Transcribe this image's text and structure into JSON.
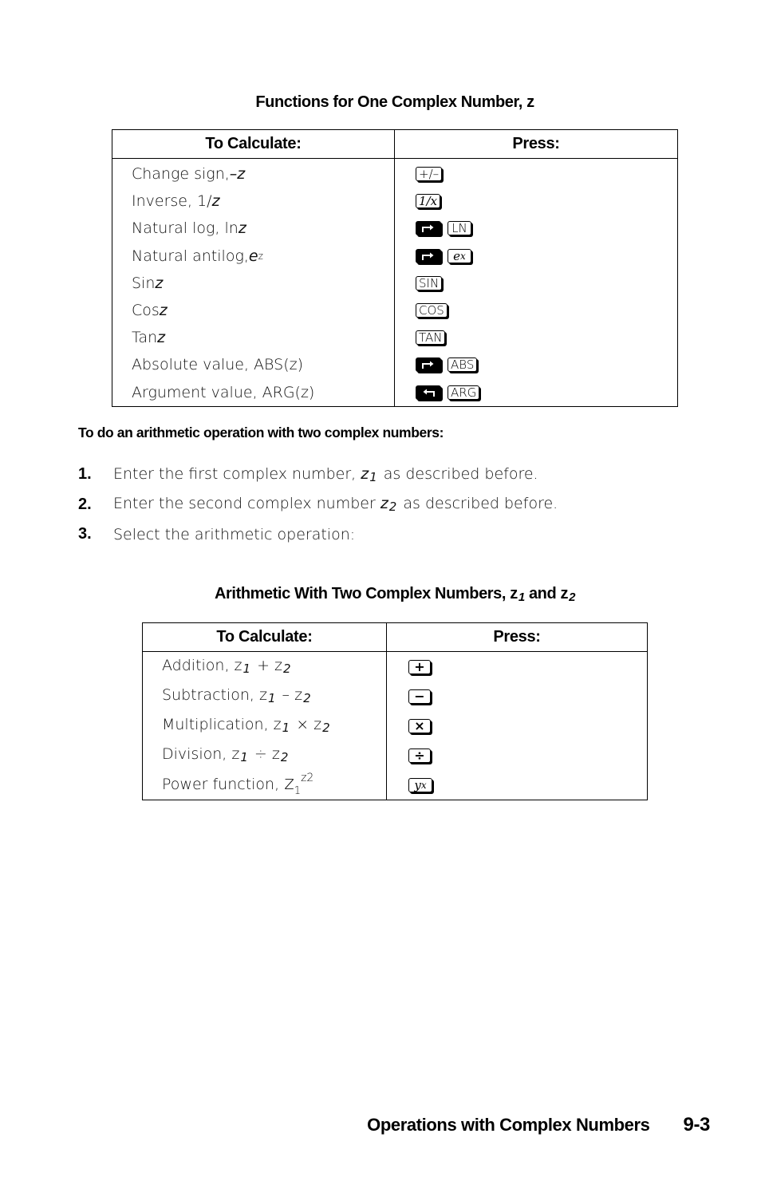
{
  "table1": {
    "title": "Functions for One Complex Number, z",
    "headers": {
      "calc": "To Calculate:",
      "press": "Press:"
    },
    "rows": [
      {
        "label": "Change sign, ",
        "var": "–z",
        "keys": [
          {
            "icon": "plus-minus-key",
            "text": "+/–",
            "style": "normal"
          }
        ]
      },
      {
        "label": "Inverse, 1/",
        "var": "z",
        "keys": [
          {
            "icon": "inverse-key",
            "text": "1/x",
            "style": "serif"
          }
        ]
      },
      {
        "label": "Natural log, ln ",
        "var": "z",
        "keys": [
          {
            "icon": "right-shift-key",
            "text": "",
            "style": "dark-right"
          },
          {
            "icon": "ln-key",
            "text": "LN",
            "style": "normal"
          }
        ]
      },
      {
        "label": "Natural antilog, ",
        "var": "e",
        "sup": "z",
        "keys": [
          {
            "icon": "right-shift-key",
            "text": "",
            "style": "dark-right"
          },
          {
            "icon": "exp-key",
            "text": "e",
            "sup": "x",
            "style": "serif"
          }
        ]
      },
      {
        "label": "Sin ",
        "var": "z",
        "keys": [
          {
            "icon": "sin-key",
            "text": "SIN",
            "style": "normal"
          }
        ]
      },
      {
        "label": "Cos ",
        "var": "z",
        "keys": [
          {
            "icon": "cos-key",
            "text": "COS",
            "style": "normal"
          }
        ]
      },
      {
        "label": "Tan ",
        "var": "z",
        "keys": [
          {
            "icon": "tan-key",
            "text": "TAN",
            "style": "normal"
          }
        ]
      },
      {
        "label": "Absolute value, ABS(z)",
        "var": "",
        "keys": [
          {
            "icon": "right-shift-key",
            "text": "",
            "style": "dark-right"
          },
          {
            "icon": "abs-key",
            "text": "ABS",
            "style": "normal"
          }
        ]
      },
      {
        "label": "Argument value, ARG(z)",
        "var": "",
        "keys": [
          {
            "icon": "left-shift-key",
            "text": "",
            "style": "dark-left"
          },
          {
            "icon": "arg-key",
            "text": "ARG",
            "style": "normal"
          }
        ]
      }
    ]
  },
  "procedure": {
    "heading": "To do an arithmetic operation with two complex numbers:",
    "steps": [
      {
        "num": "1.",
        "before": "Enter the first complex number, ",
        "var": "z",
        "sub": "1",
        "after": " as described before."
      },
      {
        "num": "2.",
        "before": "Enter the second complex number ",
        "var": "z",
        "sub": "2",
        "after": " as described before."
      },
      {
        "num": "3.",
        "before": "Select the arithmetic operation:",
        "var": "",
        "sub": "",
        "after": ""
      }
    ]
  },
  "table2": {
    "title_main": "Arithmetic With Two Complex Numbers, z",
    "title_sub1": "1",
    "title_and": " and z",
    "title_sub2": "2",
    "headers": {
      "calc": "To Calculate:",
      "press": "Press:"
    },
    "rows": [
      {
        "label": "Addition, z",
        "op": " + z",
        "key": {
          "icon": "plus-key",
          "text": "+"
        }
      },
      {
        "label": "Subtraction, z",
        "op": " – z",
        "key": {
          "icon": "minus-key",
          "text": "−"
        }
      },
      {
        "label": "Multiplication, z",
        "op": " × z",
        "key": {
          "icon": "multiply-key",
          "text": "×"
        }
      },
      {
        "label": "Division, z",
        "op": " ÷ z",
        "key": {
          "icon": "divide-key",
          "text": "÷"
        }
      }
    ],
    "power_row": {
      "label": "Power function, ",
      "base": "z",
      "base_sub": "1",
      "exp": "z2",
      "key": {
        "icon": "power-key",
        "text": "y",
        "sup": "x"
      }
    },
    "sub1": "1",
    "sub2": "2"
  },
  "footer": {
    "chapter": "Operations with Complex Numbers",
    "page": "9-3"
  }
}
